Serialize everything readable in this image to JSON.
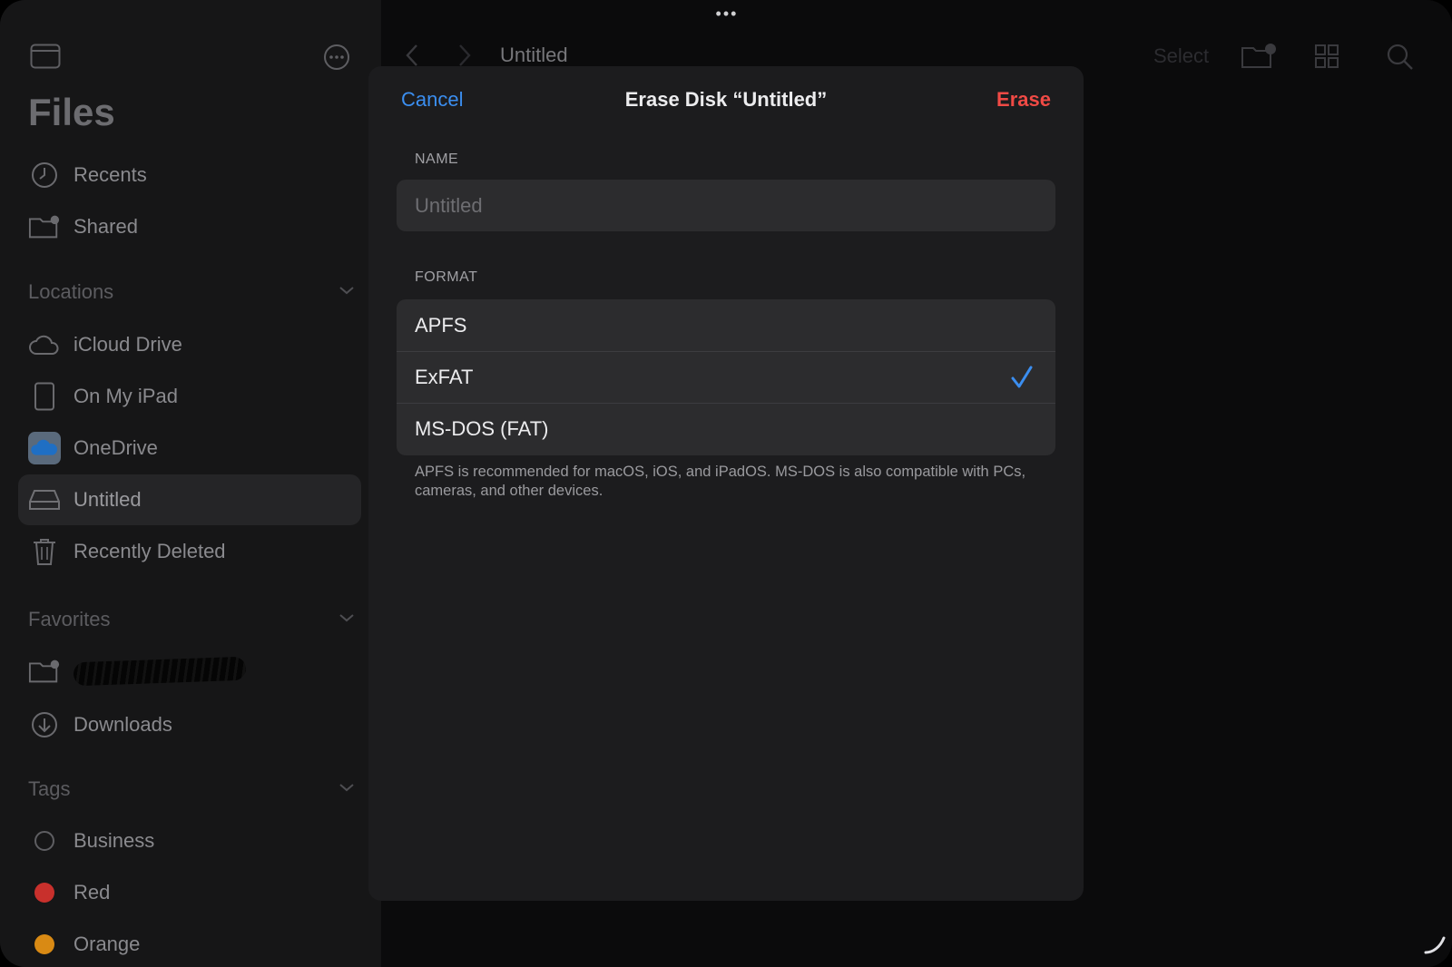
{
  "sidebar": {
    "title": "Files",
    "top_items": [
      {
        "label": "Recents",
        "icon": "clock-icon"
      },
      {
        "label": "Shared",
        "icon": "shared-folder-icon"
      }
    ],
    "locations": {
      "header": "Locations",
      "items": [
        {
          "label": "iCloud Drive",
          "icon": "cloud-icon"
        },
        {
          "label": "On My iPad",
          "icon": "ipad-icon"
        },
        {
          "label": "OneDrive",
          "icon": "onedrive-icon"
        },
        {
          "label": "Untitled",
          "icon": "drive-icon",
          "selected": true
        },
        {
          "label": "Recently Deleted",
          "icon": "trash-icon"
        }
      ]
    },
    "favorites": {
      "header": "Favorites",
      "items": [
        {
          "label": "",
          "icon": "shared-folder-icon",
          "redacted": true
        },
        {
          "label": "Downloads",
          "icon": "download-circle-icon"
        }
      ]
    },
    "tags": {
      "header": "Tags",
      "items": [
        {
          "label": "Business",
          "color": "none"
        },
        {
          "label": "Red",
          "color": "#c8302c"
        },
        {
          "label": "Orange",
          "color": "#d98a14"
        }
      ]
    }
  },
  "toolbar": {
    "title": "Untitled",
    "select_label": "Select"
  },
  "dialog": {
    "cancel_label": "Cancel",
    "title": "Erase Disk “Untitled”",
    "erase_label": "Erase",
    "name_section": "NAME",
    "name_placeholder": "Untitled",
    "name_value": "",
    "format_section": "FORMAT",
    "formats": [
      "APFS",
      "ExFAT",
      "MS-DOS (FAT)"
    ],
    "selected_format": "ExFAT",
    "footnote": "APFS is recommended for macOS, iOS, and iPadOS. MS-DOS is also compatible with PCs, cameras, and other devices."
  },
  "colors": {
    "accent": "#3b8ef0",
    "destructive": "#f04a45"
  }
}
